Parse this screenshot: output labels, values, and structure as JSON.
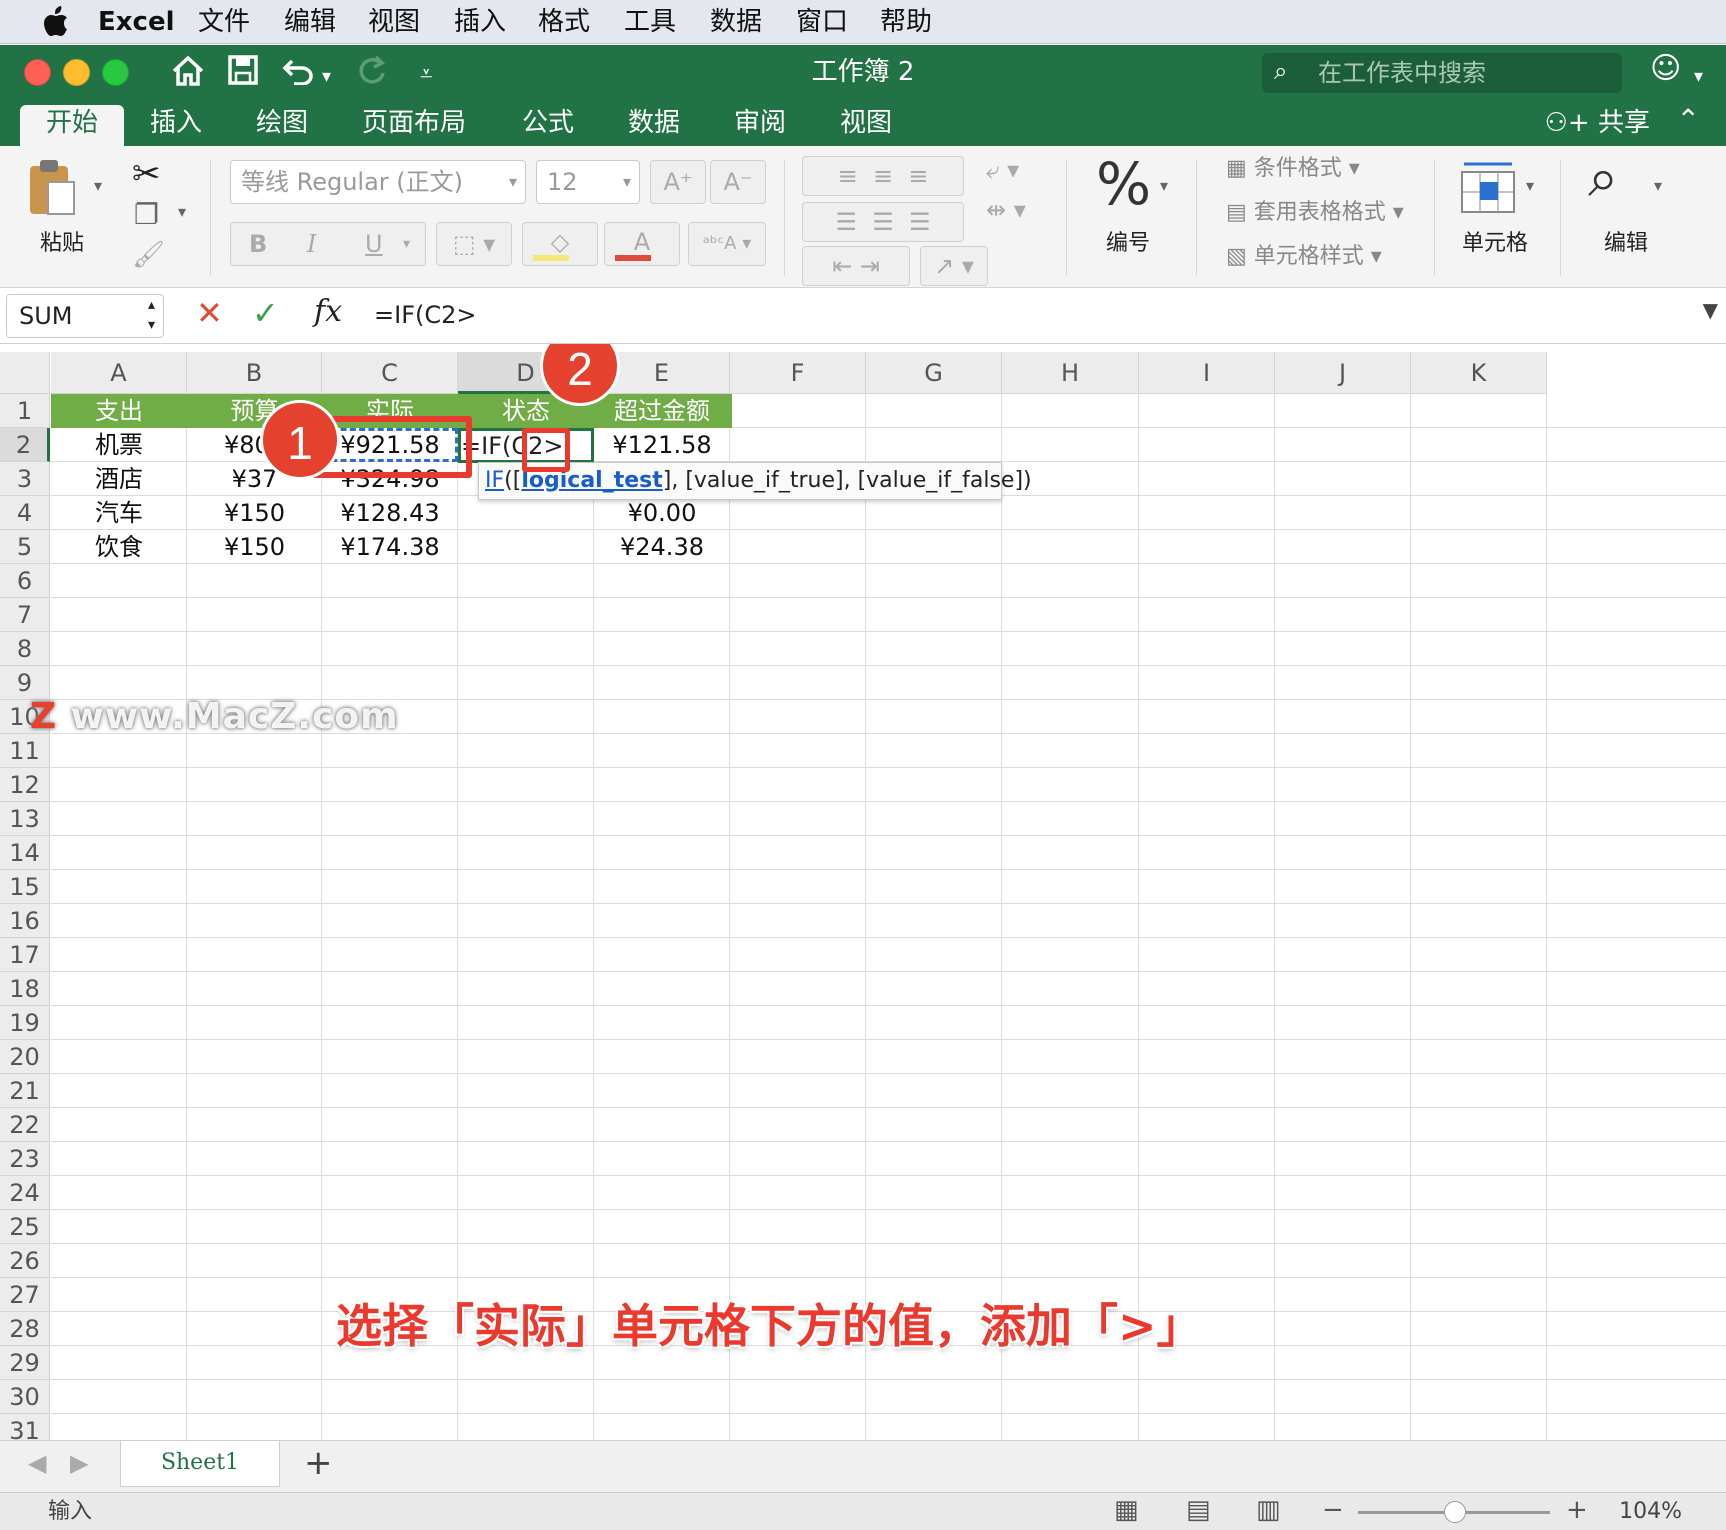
{
  "menubar": {
    "app": "Excel",
    "items": [
      "文件",
      "编辑",
      "视图",
      "插入",
      "格式",
      "工具",
      "数据",
      "窗口",
      "帮助"
    ]
  },
  "window": {
    "title": "工作簿 2",
    "search_placeholder": "在工作表中搜索"
  },
  "ribbon": {
    "tabs": [
      "开始",
      "插入",
      "绘图",
      "页面布局",
      "公式",
      "数据",
      "审阅",
      "视图"
    ],
    "active_tab": "开始",
    "share": "共享",
    "paste": "粘贴",
    "font_name": "等线 Regular (正文)",
    "font_size": "12",
    "number": "编号",
    "cond_format": "条件格式",
    "table_format": "套用表格格式",
    "cell_style": "单元格样式",
    "cells": "单元格",
    "edit": "编辑"
  },
  "formula_bar": {
    "name_box": "SUM",
    "formula": "=IF(C2>"
  },
  "grid": {
    "columns": [
      "A",
      "B",
      "C",
      "D",
      "E",
      "F",
      "G",
      "H",
      "I",
      "J",
      "K"
    ],
    "rows": [
      "1",
      "2",
      "3",
      "4",
      "5",
      "6",
      "7",
      "8",
      "9",
      "10",
      "11",
      "12",
      "13",
      "14",
      "15",
      "16",
      "17",
      "18",
      "19",
      "20",
      "21",
      "22",
      "23",
      "24",
      "25",
      "26",
      "27",
      "28",
      "29",
      "30",
      "31"
    ],
    "header": [
      "支出",
      "预算",
      "实际",
      "状态",
      "超过金额"
    ],
    "data": [
      [
        "机票",
        "¥800",
        "¥921.58",
        "=IF(C2>",
        "¥121.58"
      ],
      [
        "酒店",
        "¥37",
        "¥324.98",
        "",
        ""
      ],
      [
        "汽车",
        "¥150",
        "¥128.43",
        "",
        "¥0.00"
      ],
      [
        "饮食",
        "¥150",
        "¥174.38",
        "",
        "¥24.38"
      ]
    ],
    "tooltip": {
      "fn": "IF",
      "open": "([",
      "arg1": "logical_test",
      "rest": "], [value_if_true], [value_if_false])"
    }
  },
  "annotations": {
    "badge1": "1",
    "badge2": "2",
    "caption": "选择「实际」单元格下方的值，添加「>」",
    "watermark": "www.MacZ.com"
  },
  "sheets": {
    "tabs": [
      "Sheet1"
    ],
    "add": "+"
  },
  "status": {
    "mode": "输入",
    "zoom": "104%"
  },
  "colors": {
    "excel_green": "#217346",
    "header_fill": "#70ad47",
    "annotation_red": "#ea3a2e"
  }
}
